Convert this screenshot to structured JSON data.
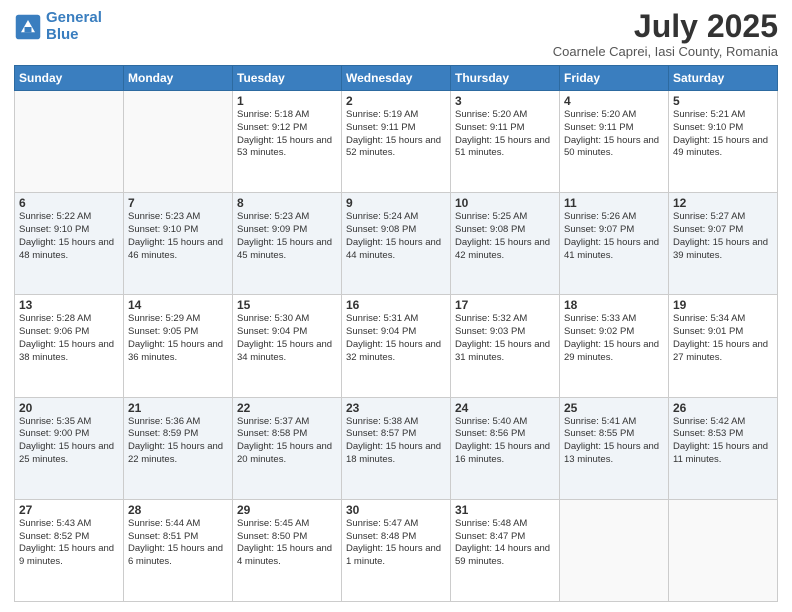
{
  "header": {
    "logo_line1": "General",
    "logo_line2": "Blue",
    "month": "July 2025",
    "location": "Coarnele Caprei, Iasi County, Romania"
  },
  "weekdays": [
    "Sunday",
    "Monday",
    "Tuesday",
    "Wednesday",
    "Thursday",
    "Friday",
    "Saturday"
  ],
  "weeks": [
    [
      {
        "day": "",
        "sunrise": "",
        "sunset": "",
        "daylight": ""
      },
      {
        "day": "",
        "sunrise": "",
        "sunset": "",
        "daylight": ""
      },
      {
        "day": "1",
        "sunrise": "Sunrise: 5:18 AM",
        "sunset": "Sunset: 9:12 PM",
        "daylight": "Daylight: 15 hours and 53 minutes."
      },
      {
        "day": "2",
        "sunrise": "Sunrise: 5:19 AM",
        "sunset": "Sunset: 9:11 PM",
        "daylight": "Daylight: 15 hours and 52 minutes."
      },
      {
        "day": "3",
        "sunrise": "Sunrise: 5:20 AM",
        "sunset": "Sunset: 9:11 PM",
        "daylight": "Daylight: 15 hours and 51 minutes."
      },
      {
        "day": "4",
        "sunrise": "Sunrise: 5:20 AM",
        "sunset": "Sunset: 9:11 PM",
        "daylight": "Daylight: 15 hours and 50 minutes."
      },
      {
        "day": "5",
        "sunrise": "Sunrise: 5:21 AM",
        "sunset": "Sunset: 9:10 PM",
        "daylight": "Daylight: 15 hours and 49 minutes."
      }
    ],
    [
      {
        "day": "6",
        "sunrise": "Sunrise: 5:22 AM",
        "sunset": "Sunset: 9:10 PM",
        "daylight": "Daylight: 15 hours and 48 minutes."
      },
      {
        "day": "7",
        "sunrise": "Sunrise: 5:23 AM",
        "sunset": "Sunset: 9:10 PM",
        "daylight": "Daylight: 15 hours and 46 minutes."
      },
      {
        "day": "8",
        "sunrise": "Sunrise: 5:23 AM",
        "sunset": "Sunset: 9:09 PM",
        "daylight": "Daylight: 15 hours and 45 minutes."
      },
      {
        "day": "9",
        "sunrise": "Sunrise: 5:24 AM",
        "sunset": "Sunset: 9:08 PM",
        "daylight": "Daylight: 15 hours and 44 minutes."
      },
      {
        "day": "10",
        "sunrise": "Sunrise: 5:25 AM",
        "sunset": "Sunset: 9:08 PM",
        "daylight": "Daylight: 15 hours and 42 minutes."
      },
      {
        "day": "11",
        "sunrise": "Sunrise: 5:26 AM",
        "sunset": "Sunset: 9:07 PM",
        "daylight": "Daylight: 15 hours and 41 minutes."
      },
      {
        "day": "12",
        "sunrise": "Sunrise: 5:27 AM",
        "sunset": "Sunset: 9:07 PM",
        "daylight": "Daylight: 15 hours and 39 minutes."
      }
    ],
    [
      {
        "day": "13",
        "sunrise": "Sunrise: 5:28 AM",
        "sunset": "Sunset: 9:06 PM",
        "daylight": "Daylight: 15 hours and 38 minutes."
      },
      {
        "day": "14",
        "sunrise": "Sunrise: 5:29 AM",
        "sunset": "Sunset: 9:05 PM",
        "daylight": "Daylight: 15 hours and 36 minutes."
      },
      {
        "day": "15",
        "sunrise": "Sunrise: 5:30 AM",
        "sunset": "Sunset: 9:04 PM",
        "daylight": "Daylight: 15 hours and 34 minutes."
      },
      {
        "day": "16",
        "sunrise": "Sunrise: 5:31 AM",
        "sunset": "Sunset: 9:04 PM",
        "daylight": "Daylight: 15 hours and 32 minutes."
      },
      {
        "day": "17",
        "sunrise": "Sunrise: 5:32 AM",
        "sunset": "Sunset: 9:03 PM",
        "daylight": "Daylight: 15 hours and 31 minutes."
      },
      {
        "day": "18",
        "sunrise": "Sunrise: 5:33 AM",
        "sunset": "Sunset: 9:02 PM",
        "daylight": "Daylight: 15 hours and 29 minutes."
      },
      {
        "day": "19",
        "sunrise": "Sunrise: 5:34 AM",
        "sunset": "Sunset: 9:01 PM",
        "daylight": "Daylight: 15 hours and 27 minutes."
      }
    ],
    [
      {
        "day": "20",
        "sunrise": "Sunrise: 5:35 AM",
        "sunset": "Sunset: 9:00 PM",
        "daylight": "Daylight: 15 hours and 25 minutes."
      },
      {
        "day": "21",
        "sunrise": "Sunrise: 5:36 AM",
        "sunset": "Sunset: 8:59 PM",
        "daylight": "Daylight: 15 hours and 22 minutes."
      },
      {
        "day": "22",
        "sunrise": "Sunrise: 5:37 AM",
        "sunset": "Sunset: 8:58 PM",
        "daylight": "Daylight: 15 hours and 20 minutes."
      },
      {
        "day": "23",
        "sunrise": "Sunrise: 5:38 AM",
        "sunset": "Sunset: 8:57 PM",
        "daylight": "Daylight: 15 hours and 18 minutes."
      },
      {
        "day": "24",
        "sunrise": "Sunrise: 5:40 AM",
        "sunset": "Sunset: 8:56 PM",
        "daylight": "Daylight: 15 hours and 16 minutes."
      },
      {
        "day": "25",
        "sunrise": "Sunrise: 5:41 AM",
        "sunset": "Sunset: 8:55 PM",
        "daylight": "Daylight: 15 hours and 13 minutes."
      },
      {
        "day": "26",
        "sunrise": "Sunrise: 5:42 AM",
        "sunset": "Sunset: 8:53 PM",
        "daylight": "Daylight: 15 hours and 11 minutes."
      }
    ],
    [
      {
        "day": "27",
        "sunrise": "Sunrise: 5:43 AM",
        "sunset": "Sunset: 8:52 PM",
        "daylight": "Daylight: 15 hours and 9 minutes."
      },
      {
        "day": "28",
        "sunrise": "Sunrise: 5:44 AM",
        "sunset": "Sunset: 8:51 PM",
        "daylight": "Daylight: 15 hours and 6 minutes."
      },
      {
        "day": "29",
        "sunrise": "Sunrise: 5:45 AM",
        "sunset": "Sunset: 8:50 PM",
        "daylight": "Daylight: 15 hours and 4 minutes."
      },
      {
        "day": "30",
        "sunrise": "Sunrise: 5:47 AM",
        "sunset": "Sunset: 8:48 PM",
        "daylight": "Daylight: 15 hours and 1 minute."
      },
      {
        "day": "31",
        "sunrise": "Sunrise: 5:48 AM",
        "sunset": "Sunset: 8:47 PM",
        "daylight": "Daylight: 14 hours and 59 minutes."
      },
      {
        "day": "",
        "sunrise": "",
        "sunset": "",
        "daylight": ""
      },
      {
        "day": "",
        "sunrise": "",
        "sunset": "",
        "daylight": ""
      }
    ]
  ]
}
